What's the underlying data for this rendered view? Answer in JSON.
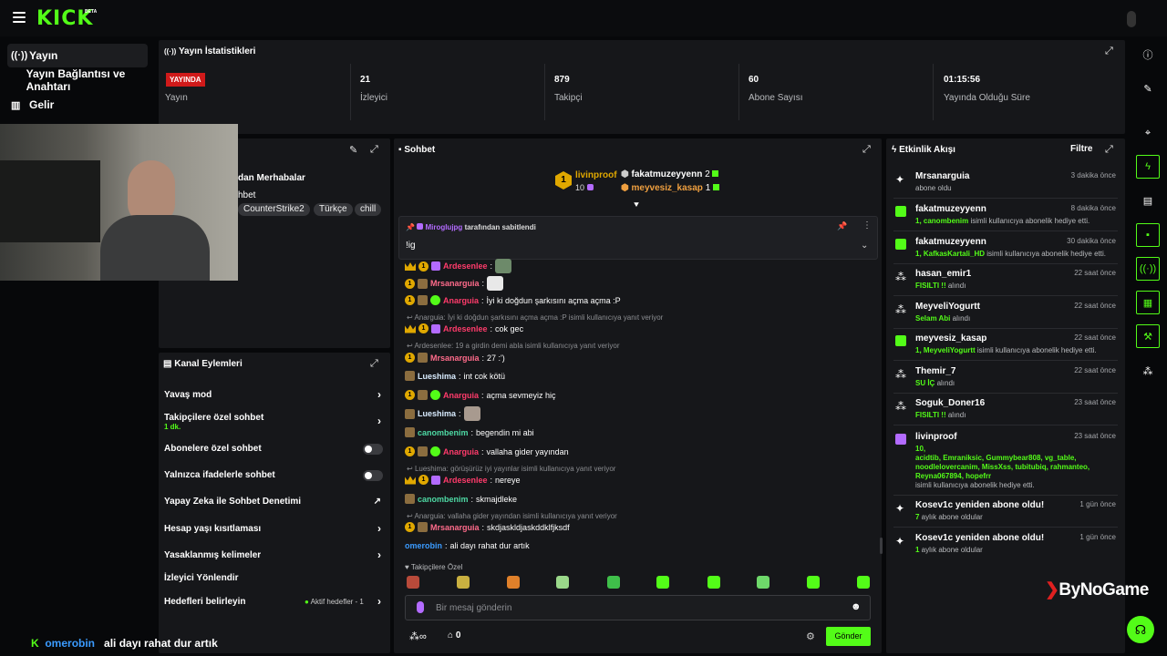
{
  "app": {
    "logo": "KICK",
    "beta": "BETA"
  },
  "nav": [
    {
      "label": "Yayın",
      "icon": "broadcast-icon"
    },
    {
      "label": "Yayın Bağlantısı ve Anahtarı",
      "icon": "key-icon"
    },
    {
      "label": "Gelir",
      "icon": "chart-icon"
    }
  ],
  "stats": {
    "title": "Yayın İstatistikleri",
    "live_badge": "YAYINDA",
    "items": [
      {
        "value": "",
        "label": "Yayın"
      },
      {
        "value": "21",
        "label": "İzleyici"
      },
      {
        "value": "879",
        "label": "Takipçi"
      },
      {
        "value": "60",
        "label": "Abone Sayısı"
      },
      {
        "value": "01:15:56",
        "label": "Yayında Olduğu Süre"
      }
    ]
  },
  "stream_info": {
    "title_fragment": "dan Merhabalar",
    "subtitle_fragment": "hbet",
    "tags": [
      "CounterStrike2",
      "Türkçe",
      "chill"
    ]
  },
  "actions": {
    "title": "Kanal Eylemleri",
    "items": [
      {
        "label": "Yavaş mod",
        "control": "chevron"
      },
      {
        "label": "Takipçilere özel sohbet",
        "sub": "1 dk.",
        "control": "chevron"
      },
      {
        "label": "Abonelere özel sohbet",
        "control": "toggle"
      },
      {
        "label": "Yalnızca ifadelerle sohbet",
        "control": "toggle"
      },
      {
        "label": "Yapay Zeka ile Sohbet Denetimi",
        "control": "external"
      },
      {
        "label": "Hesap yaşı kısıtlaması",
        "control": "chevron"
      },
      {
        "label": "Yasaklanmış kelimeler",
        "control": "chevron"
      },
      {
        "label": "İzleyici Yönlendir",
        "control": "none"
      },
      {
        "label": "Hedefleri belirleyin",
        "control": "chevron",
        "status": "Aktif hedefler - 1"
      }
    ]
  },
  "chat": {
    "title": "Sohbet",
    "leaderboard": {
      "top": {
        "rank": "1",
        "name": "livinproof",
        "count": "10"
      },
      "others": [
        {
          "name": "fakatmuzeyyenn",
          "count": "2"
        },
        {
          "name": "meyvesiz_kasap",
          "count": "1"
        }
      ]
    },
    "pinned": {
      "by": "Miroglujpg",
      "by_suffix": "tarafından sabitlendi",
      "text": "!ig"
    },
    "messages": [
      {
        "type": "msg",
        "user": "Ardesenlee",
        "color": "#ff3b6b",
        "text": ""
      },
      {
        "type": "msg",
        "user": "Mrsanarguia",
        "color": "#ff6b8b",
        "text": ""
      },
      {
        "type": "msg",
        "user": "Anarguia",
        "color": "#ff3b6b",
        "text": "İyi ki doğdun şarkısını açma açma :P"
      },
      {
        "type": "reply",
        "text": "Anarguia: İyi ki doğdun şarkısını açma açma :P isimli kullanıcıya yanıt veriyor"
      },
      {
        "type": "msg",
        "user": "Ardesenlee",
        "color": "#ff3b6b",
        "text": "cok gec"
      },
      {
        "type": "reply",
        "text": "Ardesenlee: 19 a girdin demi abla isimli kullanıcıya yanıt veriyor"
      },
      {
        "type": "msg",
        "user": "Mrsanarguia",
        "color": "#ff6b8b",
        "text": "27 :')"
      },
      {
        "type": "msg",
        "user": "Lueshima",
        "color": "#d9ecff",
        "text": "int cok kötü"
      },
      {
        "type": "msg",
        "user": "Anarguia",
        "color": "#ff3b6b",
        "text": "açma sevmeyiz hiç"
      },
      {
        "type": "msg",
        "user": "Lueshima",
        "color": "#d9ecff",
        "text": ""
      },
      {
        "type": "msg",
        "user": "canombenim",
        "color": "#4ed9a4",
        "text": "begendin mi abi"
      },
      {
        "type": "msg",
        "user": "Anarguia",
        "color": "#ff3b6b",
        "text": "vallaha gider yayından"
      },
      {
        "type": "reply",
        "text": "Lueshima: görüşürüz iyi yayınlar isimli kullanıcıya yanıt veriyor"
      },
      {
        "type": "msg",
        "user": "Ardesenlee",
        "color": "#ff3b6b",
        "text": "nereye"
      },
      {
        "type": "msg",
        "user": "canombenim",
        "color": "#4ed9a4",
        "text": "skmajdleke"
      },
      {
        "type": "reply",
        "text": "Anarguia: vallaha gider yayından isimli kullanıcıya yanıt veriyor"
      },
      {
        "type": "msg",
        "user": "Mrsanarguia",
        "color": "#ff6b8b",
        "text": "skdjaskldjaskddklfjksdf"
      },
      {
        "type": "msg",
        "user": "omerobin",
        "color": "#3b9bff",
        "text": "ali dayı rahat dur artık"
      }
    ],
    "emote_section": "Takipçilere Özel",
    "input_placeholder": "Bir mesaj gönderin",
    "points": "0",
    "send": "Gönder"
  },
  "feed": {
    "title": "Etkinlik Akışı",
    "filter": "Filtre",
    "items": [
      {
        "name": "Mrsanarguia",
        "time": "3 dakika önce",
        "hl": "",
        "sub": "abone oldu",
        "icon": "sparkle-icon"
      },
      {
        "name": "fakatmuzeyyenn",
        "time": "8 dakika önce",
        "hl": "1, canombenim",
        "sub": " isimli kullanıcıya abonelik hediye etti.",
        "icon": "gift-icon"
      },
      {
        "name": "fakatmuzeyyenn",
        "time": "30 dakika önce",
        "hl": "1, KafkasKartali_HD",
        "sub": " isimli kullanıcıya abonelik hediye etti.",
        "icon": "gift-icon"
      },
      {
        "name": "hasan_emir1",
        "time": "22 saat önce",
        "hl": "FISILTI !!",
        "sub": " alındı",
        "icon": "points-icon"
      },
      {
        "name": "MeyveliYogurtt",
        "time": "22 saat önce",
        "hl": "Selam Abi",
        "sub": " alındı",
        "icon": "points-icon"
      },
      {
        "name": "meyvesiz_kasap",
        "time": "22 saat önce",
        "hl": "1, MeyveliYogurtt",
        "sub": " isimli kullanıcıya abonelik hediye etti.",
        "icon": "gift-icon"
      },
      {
        "name": "Themir_7",
        "time": "22 saat önce",
        "hl": "SU İÇ",
        "sub": " alındı",
        "icon": "points-icon"
      },
      {
        "name": "Soguk_Doner16",
        "time": "23 saat önce",
        "hl": "FISILTI !!",
        "sub": " alındı",
        "icon": "points-icon"
      },
      {
        "name": "livinproof",
        "time": "23 saat önce",
        "hl": "10,\nacidtib, Emraniksic, Gummybear808, vg_table,\nnoodlelovercanim, MissXss, tubitubiq, rahmanteo,\nReyna067894, hopefrr",
        "sub": "isimli kullanıcıya abonelik hediye etti.",
        "icon": "gift-icon"
      },
      {
        "name": "Kosev1c yeniden abone oldu!",
        "time": "1 gün önce",
        "hl": "7",
        "sub": " aylık abone oldular",
        "icon": "sparkle-icon"
      },
      {
        "name": "Kosev1c yeniden abone oldu!",
        "time": "1 gün önce",
        "hl": "1",
        "sub": " aylık abone oldular",
        "icon": "sparkle-icon"
      }
    ]
  },
  "overlay": {
    "user": "omerobin",
    "text": "ali dayı rahat dur artık",
    "brand": "ByNoGame"
  },
  "colors": {
    "accent": "#53fc18",
    "live": "#d01a1a",
    "panel": "#16171a"
  }
}
